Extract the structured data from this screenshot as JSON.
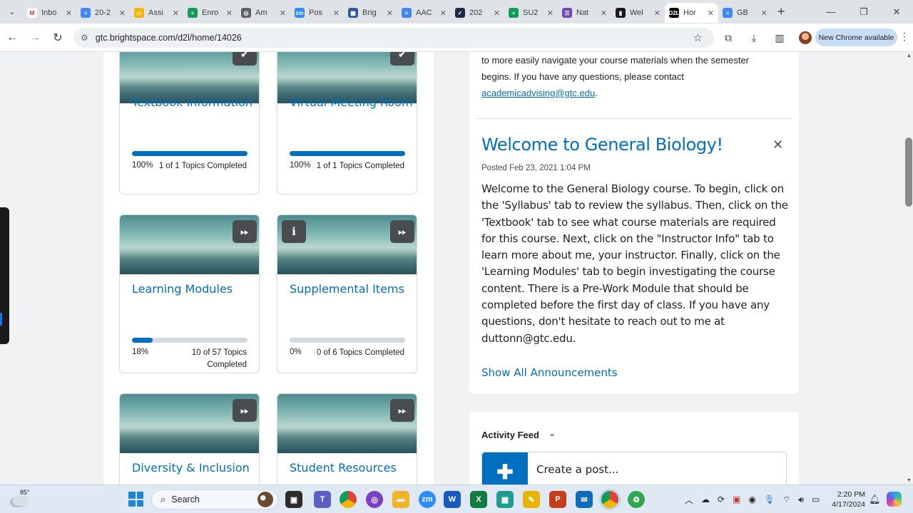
{
  "browser": {
    "tabs": [
      {
        "label": "Inbo",
        "icon": "gmail-icon",
        "color": "#ffffff",
        "glyph": "M",
        "glyph_color": "#d93025"
      },
      {
        "label": "20-2",
        "icon": "docs-icon",
        "color": "#4285f4",
        "glyph": "≡"
      },
      {
        "label": "Assi",
        "icon": "slides-icon",
        "color": "#f4b400",
        "glyph": "▭"
      },
      {
        "label": "Enro",
        "icon": "sheets-plus-icon",
        "color": "#0f9d58",
        "glyph": "+"
      },
      {
        "label": "Am",
        "icon": "globe-icon",
        "color": "#5f6368",
        "glyph": "◎"
      },
      {
        "label": "Pos",
        "icon": "zoom-icon",
        "color": "#2d8cff",
        "glyph": "zm"
      },
      {
        "label": "Brig",
        "icon": "brightspace-icon",
        "color": "#2b5aa8",
        "glyph": "▦"
      },
      {
        "label": "AAC",
        "icon": "docs-icon",
        "color": "#4285f4",
        "glyph": "≡"
      },
      {
        "label": "202",
        "icon": "checkbox-icon",
        "color": "#1f2a44",
        "glyph": "✓"
      },
      {
        "label": "SU2",
        "icon": "sheets-plus-icon",
        "color": "#0f9d58",
        "glyph": "+"
      },
      {
        "label": "Nat",
        "icon": "forms-icon",
        "color": "#7248b9",
        "glyph": "☰"
      },
      {
        "label": "Wel",
        "icon": "chart-icon",
        "color": "#1b1b1b",
        "glyph": "▮"
      },
      {
        "label": "Hor",
        "icon": "d2l-icon",
        "color": "#000000",
        "glyph": "D2L",
        "active": true
      },
      {
        "label": "GB",
        "icon": "docs-icon",
        "color": "#4285f4",
        "glyph": "≡"
      }
    ],
    "url": "gtc.brightspace.com/d2l/home/14026",
    "new_chrome_label": "New Chrome available"
  },
  "cards": [
    {
      "title": "Textbook Information",
      "percent": 100,
      "pct_label": "100%",
      "topics_label": "1 of 1 Topics Completed",
      "badge": "check"
    },
    {
      "title": "Virtual Meeting Room",
      "percent": 100,
      "pct_label": "100%",
      "topics_label": "1 of 1 Topics Completed",
      "badge": "check"
    },
    {
      "title": "Learning Modules",
      "percent": 18,
      "pct_label": "18%",
      "topics_label": "10 of 57 Topics Completed",
      "badge": "play"
    },
    {
      "title": "Supplemental Items",
      "percent": 0,
      "pct_label": "0%",
      "topics_label": "0 of 6 Topics Completed",
      "badge": "play",
      "info_badge": true
    },
    {
      "title": "Diversity & Inclusion",
      "badge": "play"
    },
    {
      "title": "Student Resources",
      "badge": "play"
    }
  ],
  "announcements": {
    "prev_text": "to more easily navigate your course materials when the semester begins.  If you have any questions, please contact",
    "prev_email": "academicadvising@gtc.edu",
    "title": "Welcome to General Biology!",
    "posted": "Posted Feb 23, 2021 1:04 PM",
    "body": "Welcome to the General Biology course. To begin, click on the 'Syllabus' tab to review the syllabus. Then, click on the 'Textbook' tab to see what course materials are required for this course. Next, click on the \"Instructor Info\" tab to learn more about me, your instructor. Finally, click on the 'Learning Modules' tab to begin investigating the course content. There is a Pre-Work Module that should be completed before the first day of class. If you have any questions, don't hesitate to reach out to me at duttonn@gtc.edu.",
    "show_all": "Show All Announcements"
  },
  "activity_feed": {
    "title": "Activity Feed",
    "create_post": "Create a post..."
  },
  "taskbar": {
    "temperature": "85°",
    "search_label": "Search",
    "time": "2:20 PM",
    "date": "4/17/2024"
  },
  "colors": {
    "accent": "#006fbf",
    "progress_track": "#d3d9e3"
  }
}
